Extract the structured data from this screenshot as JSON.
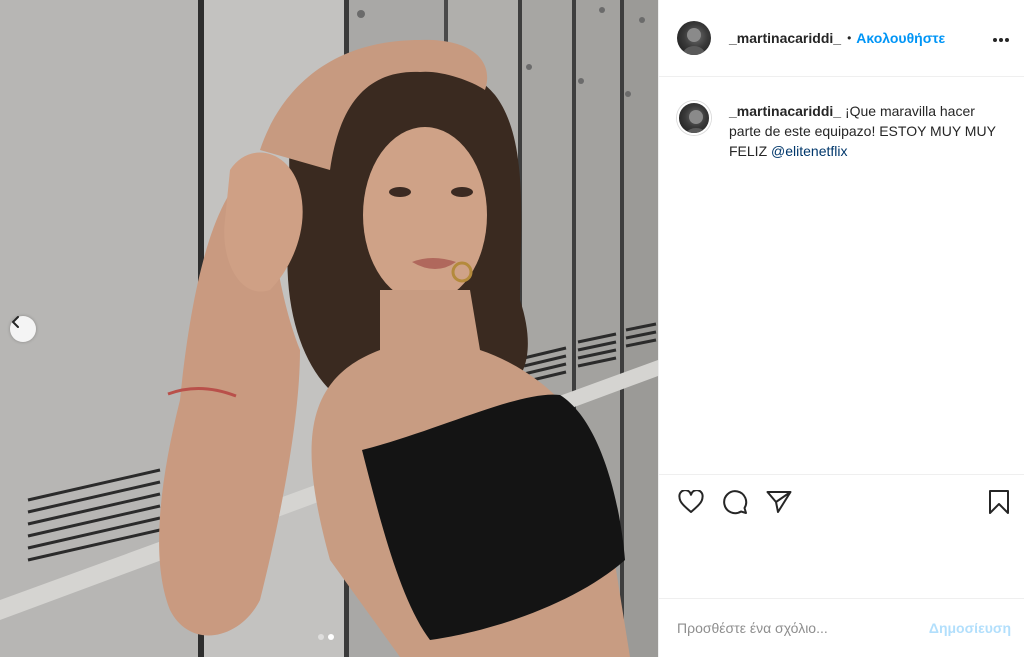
{
  "post": {
    "username": "_martinacariddi_",
    "separator": "•",
    "follow_label": "Ακολουθήστε",
    "more_icon": "more-dots-icon",
    "caption": {
      "username": "_martinacariddi_",
      "text": "¡Que maravilla hacer parte de este equipazo! ESTOY MUY MUY FELIZ",
      "mention": "@elitenetflix"
    },
    "carousel": {
      "current_index": 2,
      "total": 2,
      "prev_icon": "chevron-left-icon"
    },
    "actions": {
      "like_icon": "heart-icon",
      "comment_icon": "comment-bubble-icon",
      "share_icon": "paper-plane-icon",
      "save_icon": "bookmark-icon"
    },
    "comment_input": {
      "placeholder": "Προσθέστε ένα σχόλιο...",
      "post_label": "Δημοσίευση"
    }
  },
  "colors": {
    "accent": "#0095f6",
    "post_disabled": "#b2dffc",
    "text": "#262626",
    "muted": "#8e8e8e",
    "mention": "#00376b"
  }
}
